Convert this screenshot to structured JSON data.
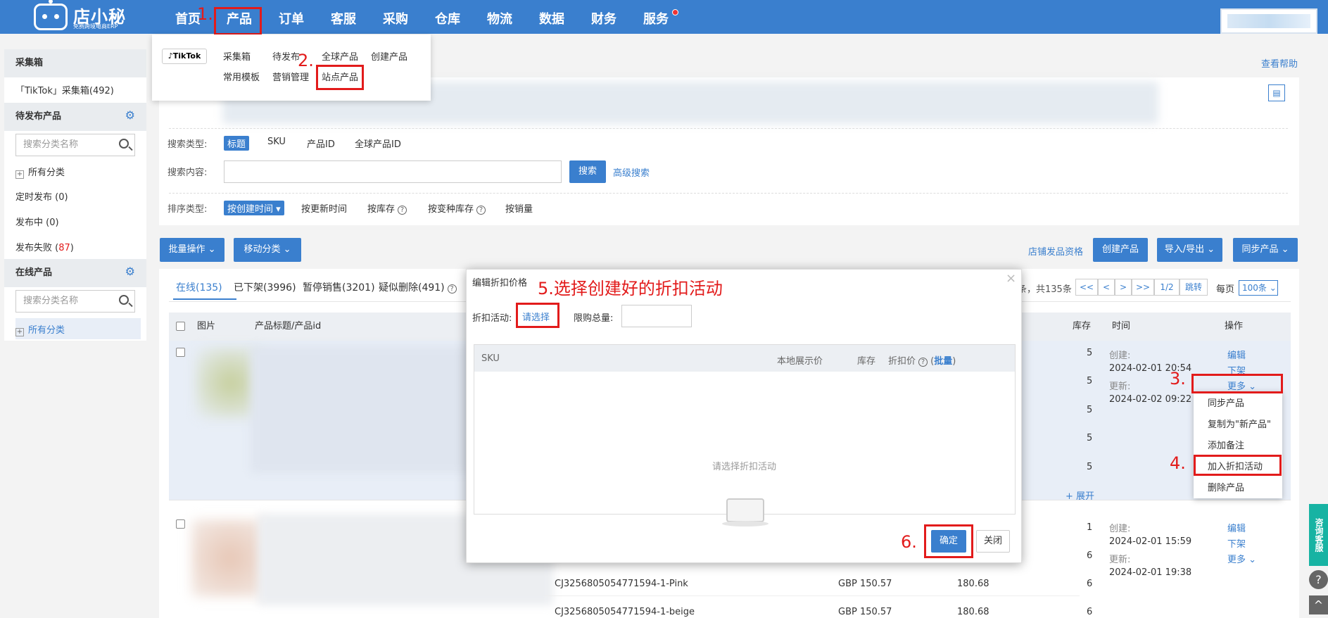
{
  "colors": {
    "brand": "#3a7fce",
    "highlight": "#e21b1b",
    "consult": "#17b3a3"
  },
  "header": {
    "logo_name": "店小秘",
    "logo_slogan": "免费跨境电商ERP",
    "nav": [
      "首页",
      "产品",
      "订单",
      "客服",
      "采购",
      "仓库",
      "物流",
      "数据",
      "财务",
      "服务"
    ]
  },
  "steps": {
    "s1": "1.",
    "s2": "2.",
    "s3": "3.",
    "s4": "4.",
    "s5": "5.选择创建好的折扣活动",
    "s6": "6."
  },
  "product_menu": {
    "platform": "TikTok",
    "row1": [
      "采集箱",
      "待发布",
      "全球产品",
      "创建产品"
    ],
    "row2": [
      "常用模板",
      "营销管理",
      "站点产品"
    ]
  },
  "sidebar": {
    "collect_head": "采集箱",
    "collect_item": "「TikTok」采集箱(492)",
    "pending_head": "待发布产品",
    "pending_search": "搜索分类名称",
    "all_categories": "所有分类",
    "scheduled": "定时发布 (0)",
    "publishing": "发布中 (0)",
    "failed_prefix": "发布失败 (",
    "failed_count": "87",
    "failed_suffix": ")",
    "online_head": "在线产品",
    "online_search": "搜索分类名称",
    "online_all": "所有分类"
  },
  "help_link": "查看帮助",
  "search": {
    "type_label": "搜索类型:",
    "types": [
      "标题",
      "SKU",
      "产品ID",
      "全球产品ID"
    ],
    "content_label": "搜索内容:",
    "search_button": "搜索",
    "advanced": "高级搜索",
    "sort_label": "排序类型:",
    "sorts": [
      "按创建时间",
      "按更新时间",
      "按库存",
      "按变种库存",
      "按销量"
    ]
  },
  "toolbar": {
    "bulk": "批量操作",
    "move": "移动分类",
    "qualification": "店铺发品资格",
    "create": "创建产品",
    "import_export": "导入/导出",
    "sync": "同步产品"
  },
  "tabs": [
    "在线(135)",
    "已下架(3996)",
    "暂停销售(3201)",
    "疑似删除(491)"
  ],
  "pager": {
    "total": "条，共135条",
    "first": "<<",
    "prev": "<",
    "next": ">",
    "last": ">>",
    "page": "1/2",
    "jump": "跳转",
    "per_page_label": "每页",
    "per_page": "100条"
  },
  "table": {
    "headers": {
      "image": "图片",
      "title": "产品标题/产品id",
      "stock": "库存",
      "time": "时间",
      "action": "操作"
    },
    "row1": {
      "stocks": [
        "5",
        "5",
        "5",
        "5",
        "5"
      ],
      "expand": "+ 展开",
      "created_label": "创建:",
      "created": "2024-02-01 20:54",
      "updated_label": "更新:",
      "updated": "2024-02-02 09:22",
      "edit": "编辑",
      "delist": "下架",
      "more": "更多"
    },
    "row2": {
      "stocks": [
        "1",
        "6",
        "6",
        "6"
      ],
      "skus": [
        "CJ3256805054771594-1-Pink",
        "CJ3256805054771594-1-beige"
      ],
      "prices": [
        "GBP 150.57",
        "GBP 150.57"
      ],
      "local_prices": [
        "180.68",
        "180.68"
      ],
      "created_label": "创建:",
      "created": "2024-02-01 15:59",
      "updated_label": "更新:",
      "updated": "2024-02-01 19:38",
      "edit": "编辑",
      "delist": "下架",
      "more": "更多"
    }
  },
  "more_menu": [
    "同步产品",
    "复制为\"新产品\"",
    "添加备注",
    "加入折扣活动",
    "删除产品"
  ],
  "modal": {
    "title": "编辑折扣价格",
    "close_x": "×",
    "activity_label": "折扣活动:",
    "activity_link": "请选择",
    "limit_label": "限购总量:",
    "limit_value": "",
    "col_sku": "SKU",
    "col_local_price": "本地展示价",
    "col_stock": "库存",
    "col_discount": "折扣价",
    "col_bulk": "批量",
    "empty": "请选择折扣活动",
    "confirm": "确定",
    "close": "关闭"
  },
  "float": {
    "consult": "咨询客服",
    "help": "?",
    "top": "^"
  }
}
